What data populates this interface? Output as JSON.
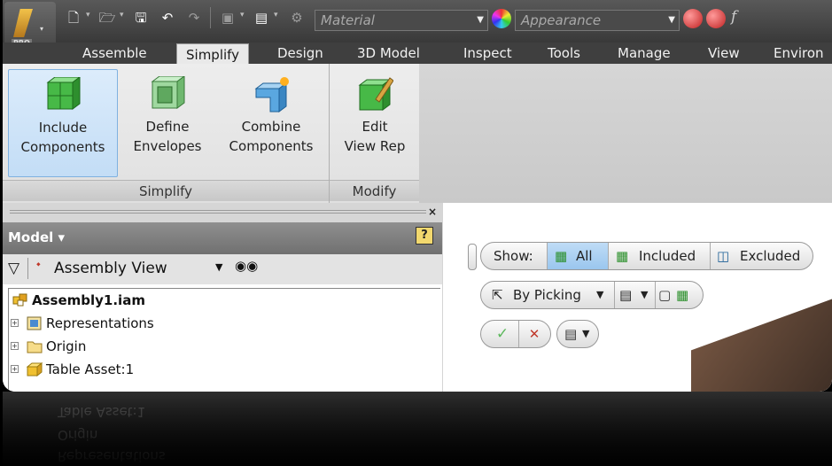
{
  "qat": {
    "material_combo": "Material",
    "appearance_combo": "Appearance",
    "app_badge": "PRO",
    "fx_symbol": "f"
  },
  "tabs": [
    "Assemble",
    "Simplify",
    "Design",
    "3D Model",
    "Inspect",
    "Tools",
    "Manage",
    "View",
    "Environ"
  ],
  "active_tab": "Simplify",
  "ribbon": {
    "simplify": {
      "label": "Simplify",
      "buttons": [
        {
          "line1": "Include",
          "line2": "Components"
        },
        {
          "line1": "Define",
          "line2": "Envelopes"
        },
        {
          "line1": "Combine",
          "line2": "Components"
        }
      ]
    },
    "modify": {
      "label": "Modify",
      "buttons": [
        {
          "line1": "Edit",
          "line2": "View Rep"
        }
      ]
    }
  },
  "browser": {
    "title": "Model ▾",
    "help": "?",
    "close": "×",
    "view_label": "Assembly View",
    "tree": [
      {
        "label": "Assembly1.iam"
      },
      {
        "label": "Representations"
      },
      {
        "label": "Origin"
      },
      {
        "label": "Table Asset:1"
      }
    ]
  },
  "minitoolbar": {
    "show_label": "Show:",
    "all_label": "All",
    "included_label": "Included",
    "excluded_label": "Excluded",
    "by_picking_label": "By Picking",
    "ok_symbol": "✓",
    "cancel_symbol": "✕"
  },
  "colors": {
    "accent_blue": "#9ac6ee",
    "ribbon_bg": "#e6e6e6",
    "tab_bar": "#3f3f3f",
    "icon_green": "#3cae3c"
  }
}
